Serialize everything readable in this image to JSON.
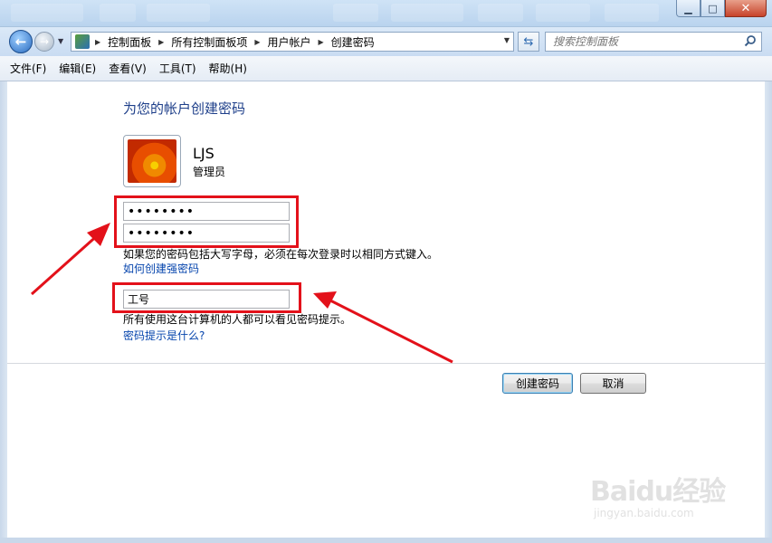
{
  "window": {
    "minimize": "▁",
    "maximize": "□",
    "close": "✕"
  },
  "address": {
    "breadcrumbs": [
      "控制面板",
      "所有控制面板项",
      "用户帐户",
      "创建密码"
    ],
    "search_placeholder": "搜索控制面板"
  },
  "menu": [
    "文件(F)",
    "编辑(E)",
    "查看(V)",
    "工具(T)",
    "帮助(H)"
  ],
  "page": {
    "title": "为您的帐户创建密码",
    "user_name": "LJS",
    "user_role": "管理员",
    "new_password": "••••••••",
    "confirm_password": "••••••••",
    "case_note": "如果您的密码包括大写字母，必须在每次登录时以相同方式键入。",
    "strong_link": "如何创建强密码",
    "hint_value": "工号",
    "hint_note": "所有使用这台计算机的人都可以看见密码提示。",
    "hint_link": "密码提示是什么?"
  },
  "buttons": {
    "create": "创建密码",
    "cancel": "取消"
  },
  "annotation_color": "#e3111a",
  "watermark": {
    "brand": "Baidu经验",
    "url": "jingyan.baidu.com"
  }
}
